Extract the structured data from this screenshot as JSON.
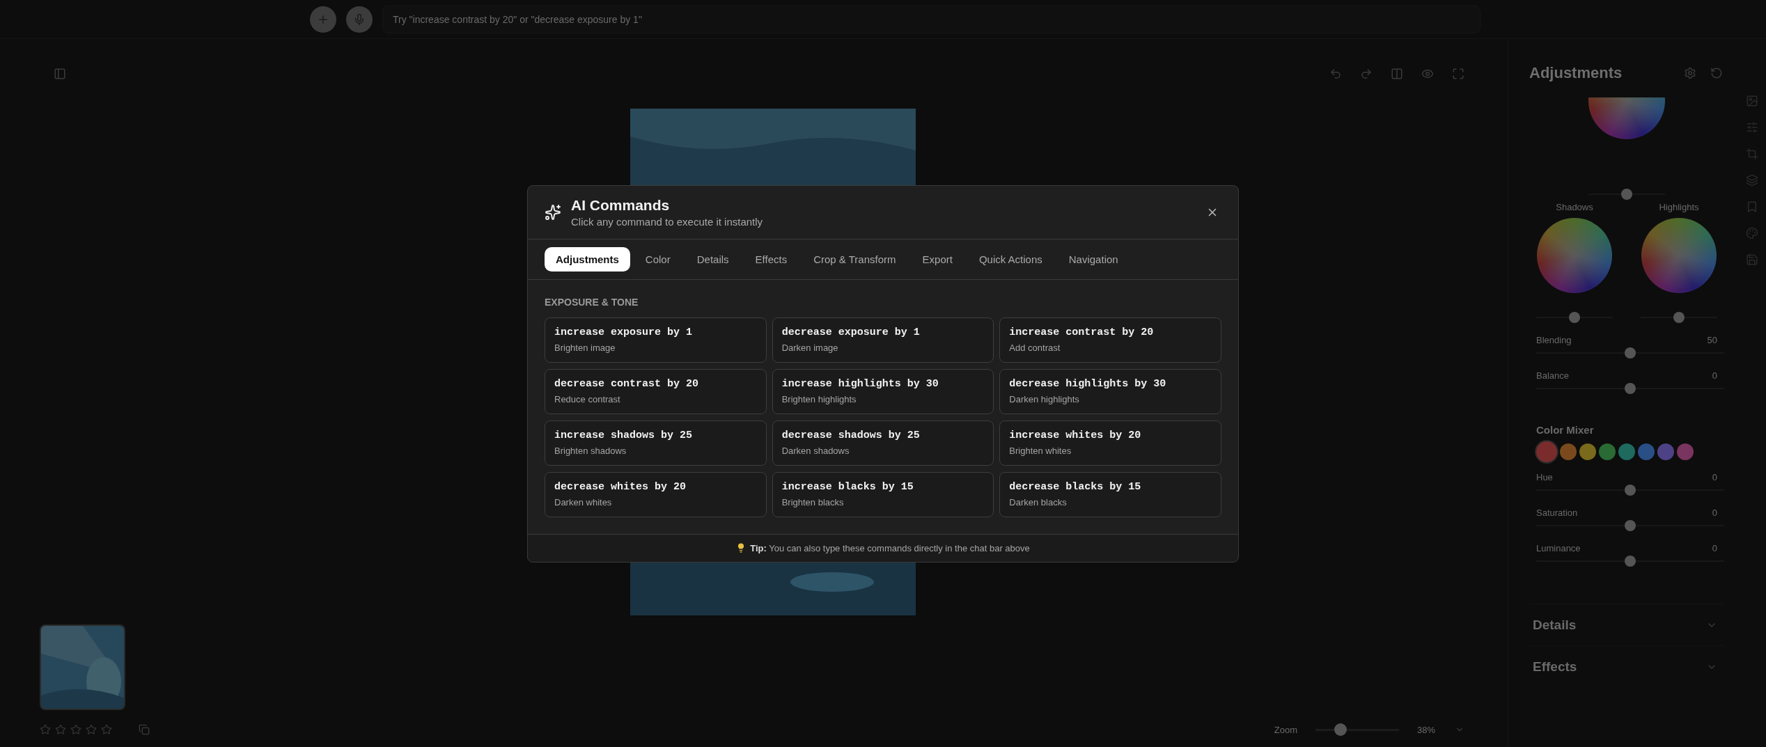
{
  "chat_bar": {
    "placeholder": "Try \"increase contrast by 20\" or \"decrease exposure by 1\""
  },
  "editor": {
    "zoom": {
      "label": "Zoom",
      "value": "38%",
      "level": 0.3
    }
  },
  "filmstrip": {
    "stars": 0
  },
  "panel": {
    "title": "Adjustments",
    "wheel_labels": [
      "Shadows",
      "Highlights"
    ],
    "sliders": [
      {
        "label": "Blending",
        "value": "50",
        "level": 0.5
      },
      {
        "label": "Balance",
        "value": "0",
        "level": 0.5
      }
    ],
    "color_mixer": {
      "title": "Color Mixer",
      "swatches": [
        {
          "color": "#7a2c2c",
          "selected": true
        },
        {
          "color": "#7a4a1e",
          "selected": false
        },
        {
          "color": "#7a6a1c",
          "selected": false
        },
        {
          "color": "#2a6a34",
          "selected": false
        },
        {
          "color": "#1f6a5e",
          "selected": false
        },
        {
          "color": "#2a4e86",
          "selected": false
        },
        {
          "color": "#4e4286",
          "selected": false
        },
        {
          "color": "#7a3460",
          "selected": false
        }
      ],
      "sliders": [
        {
          "label": "Hue",
          "value": "0",
          "level": 0.5
        },
        {
          "label": "Saturation",
          "value": "0",
          "level": 0.5
        },
        {
          "label": "Luminance",
          "value": "0",
          "level": 0.5
        }
      ]
    },
    "sections": [
      {
        "title": "Details",
        "expanded": false
      },
      {
        "title": "Effects",
        "expanded": false
      }
    ]
  },
  "modal": {
    "title": "AI Commands",
    "subtitle": "Click any command to execute it instantly",
    "tabs": [
      {
        "label": "Adjustments",
        "selected": true
      },
      {
        "label": "Color",
        "selected": false
      },
      {
        "label": "Details",
        "selected": false
      },
      {
        "label": "Effects",
        "selected": false
      },
      {
        "label": "Crop & Transform",
        "selected": false
      },
      {
        "label": "Export",
        "selected": false
      },
      {
        "label": "Quick Actions",
        "selected": false
      },
      {
        "label": "Navigation",
        "selected": false
      }
    ],
    "section_title": "EXPOSURE & TONE",
    "commands": [
      {
        "command": "increase exposure by 1",
        "description": "Brighten image"
      },
      {
        "command": "decrease exposure by 1",
        "description": "Darken image"
      },
      {
        "command": "increase contrast by 20",
        "description": "Add contrast"
      },
      {
        "command": "decrease contrast by 20",
        "description": "Reduce contrast"
      },
      {
        "command": "increase highlights by 30",
        "description": "Brighten highlights"
      },
      {
        "command": "decrease highlights by 30",
        "description": "Darken highlights"
      },
      {
        "command": "increase shadows by 25",
        "description": "Brighten shadows"
      },
      {
        "command": "decrease shadows by 25",
        "description": "Darken shadows"
      },
      {
        "command": "increase whites by 20",
        "description": "Brighten whites"
      },
      {
        "command": "decrease whites by 20",
        "description": "Darken whites"
      },
      {
        "command": "increase blacks by 15",
        "description": "Brighten blacks"
      },
      {
        "command": "decrease blacks by 15",
        "description": "Darken blacks"
      }
    ],
    "tip": "**Tip:** You can also type these commands directly in the chat bar above"
  }
}
